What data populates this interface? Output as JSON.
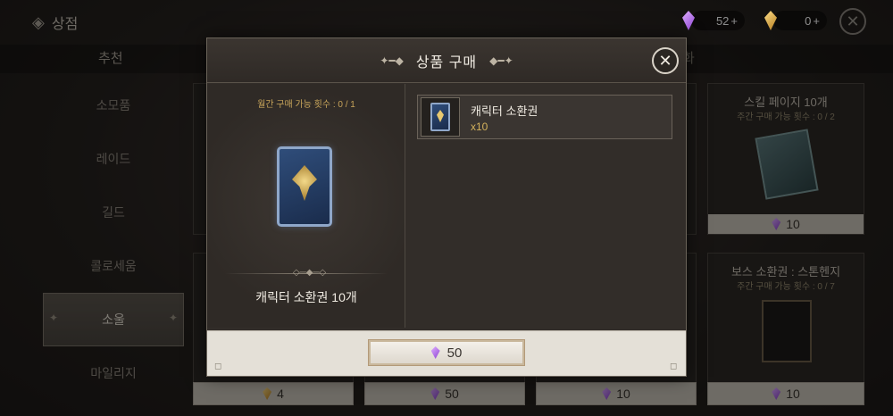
{
  "topbar": {
    "title": "상점",
    "amethyst_count": "52",
    "gold_count": "0",
    "plus": "+"
  },
  "tabs": {
    "recommended": "추천",
    "right_partial": "화"
  },
  "sidebar": {
    "items": [
      {
        "label": "소모품"
      },
      {
        "label": "레이드"
      },
      {
        "label": "길드"
      },
      {
        "label": "콜로세움"
      },
      {
        "label": "소울"
      },
      {
        "label": "마일리지"
      }
    ],
    "active_index": 4
  },
  "cards": [
    {
      "name": "스킬 페이지 10개",
      "limit": "주간 구매 가능 횟수 : 0 / 2",
      "price": "10",
      "currency": "amethyst"
    },
    {
      "name": "보스 소환권 : 스톤헨지",
      "limit": "주간 구매 가능 횟수 : 0 / 7",
      "price": "10",
      "currency": "amethyst"
    }
  ],
  "bottom_prices": [
    {
      "price": "4",
      "currency": "gold"
    },
    {
      "price": "50",
      "currency": "amethyst"
    },
    {
      "price": "10",
      "currency": "amethyst"
    },
    {
      "price": "10",
      "currency": "amethyst"
    }
  ],
  "modal": {
    "title": "상품 구매",
    "monthly_limit": "월간 구매 가능 횟수 : 0 / 1",
    "item_name": "캐릭터 소환권 10개",
    "list": [
      {
        "name": "캐릭터 소환권",
        "qty": "x10"
      }
    ],
    "price": "50",
    "colors": {
      "accent_gold": "#c7a45a",
      "amethyst": "#8a3fd0"
    }
  }
}
